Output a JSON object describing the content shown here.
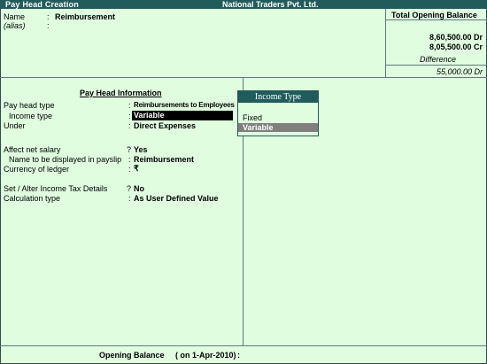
{
  "window": {
    "title": "Pay Head  Creation",
    "company": "National Traders Pvt. Ltd."
  },
  "header": {
    "name_label": "Name",
    "name_value": "Reimbursement",
    "alias_label": "(alias)",
    "colon": ":"
  },
  "balance_panel": {
    "title": "Total Opening Balance",
    "dr_value": "8,60,500.00 Dr",
    "cr_value": "8,05,500.00 Cr",
    "difference_label": "Difference",
    "difference_value": "55,000.00 Dr"
  },
  "info": {
    "section_title": "Pay Head Information",
    "pay_head_type_label": "Pay head type",
    "pay_head_type_value": "Reimbursements to Employees",
    "income_type_label": "Income type",
    "income_type_value": "Variable",
    "under_label": "Under",
    "under_value": "Direct Expenses",
    "affect_net_salary_label": "Affect net salary",
    "affect_net_salary_value": "Yes",
    "payslip_name_label": "Name to be displayed in payslip",
    "payslip_name_value": "Reimbursement",
    "currency_label": "Currency of ledger",
    "currency_value": "₹",
    "income_tax_label": "Set / Alter Income Tax Details",
    "income_tax_value": "No",
    "calculation_type_label": "Calculation type",
    "calculation_type_value": "As User Defined Value",
    "colon": ":",
    "question": "?"
  },
  "popup": {
    "title": "Income Type",
    "options": [
      "Fixed",
      "Variable"
    ],
    "selected": "Variable"
  },
  "footer": {
    "label": "Opening Balance",
    "date_text": "( on 1-Apr-2010)",
    "colon": ":"
  }
}
